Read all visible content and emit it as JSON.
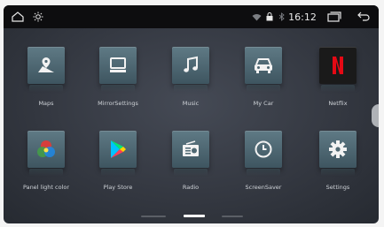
{
  "status_bar": {
    "time": "16:12",
    "icons": {
      "home": "home-icon",
      "brightness": "brightness-icon",
      "wifi": "wifi-icon",
      "lock": "lock-icon",
      "bluetooth": "bluetooth-icon",
      "recent_apps": "recent-apps-icon",
      "back": "back-icon"
    }
  },
  "apps": [
    {
      "label": "Maps",
      "icon": "maps-icon"
    },
    {
      "label": "MirrorSettings",
      "icon": "monitor-icon"
    },
    {
      "label": "Music",
      "icon": "music-note-icon"
    },
    {
      "label": "My Car",
      "icon": "car-icon"
    },
    {
      "label": "Netflix",
      "icon": "netflix-icon"
    },
    {
      "label": "Panel light color",
      "icon": "color-circles-icon"
    },
    {
      "label": "Play Store",
      "icon": "play-store-icon"
    },
    {
      "label": "Radio",
      "icon": "radio-icon"
    },
    {
      "label": "ScreenSaver",
      "icon": "clock-icon"
    },
    {
      "label": "Settings",
      "icon": "gear-icon"
    }
  ],
  "page_indicator": {
    "pages": 3,
    "current": 2
  },
  "colors": {
    "statusbar": "#0d0d0f",
    "background": "#343841",
    "tile": "#4f6872",
    "netflix_red": "#e50914"
  }
}
